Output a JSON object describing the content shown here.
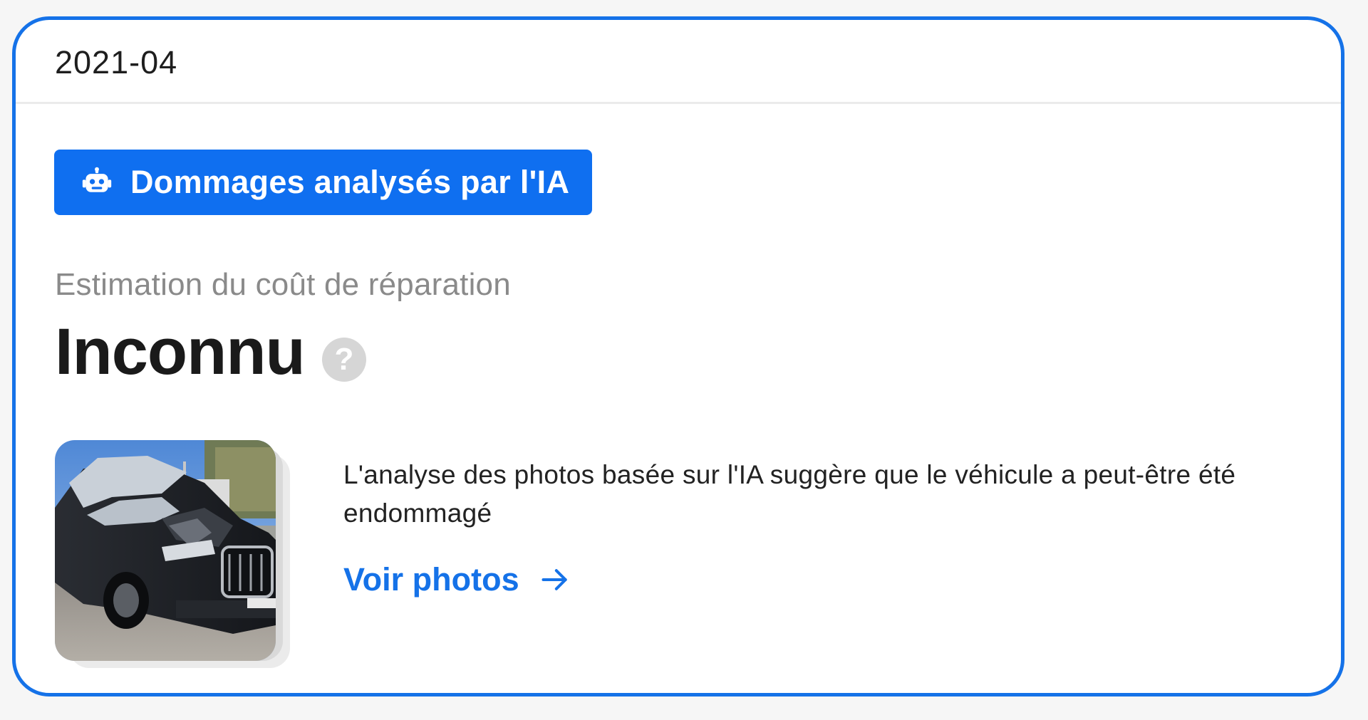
{
  "card": {
    "date": "2021-04",
    "ai_badge": {
      "label": "Dommages analysés par l'IA",
      "icon": "robot-icon"
    },
    "estimate": {
      "label": "Estimation du coût de réparation",
      "value": "Inconnu",
      "help_icon": "help-icon",
      "help_glyph": "?"
    },
    "photo": {
      "alt": "damaged car thumbnail"
    },
    "description": "L'analyse des photos basée sur l'IA suggère que le véhicule a peut-être été endommagé",
    "view_photos": {
      "label": "Voir photos",
      "icon": "arrow-right-icon"
    }
  },
  "colors": {
    "accent": "#1572e8",
    "badge_bg": "#0f6ff0",
    "muted_text": "#8a8a8a",
    "help_bg": "#d6d6d6"
  }
}
